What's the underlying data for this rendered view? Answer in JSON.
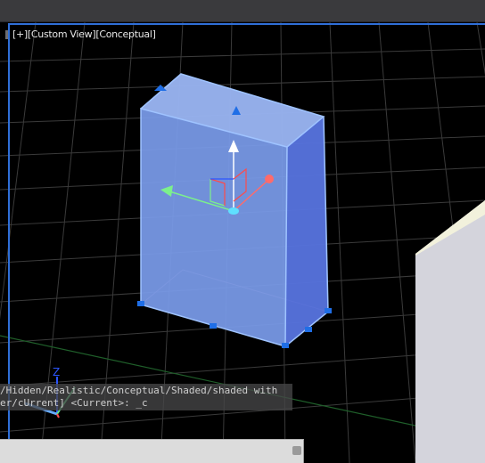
{
  "viewport": {
    "label": "[+][Custom View][Conceptual]",
    "ucs_z_label": "Z"
  },
  "command_history": {
    "line1": "/Hidden/Realistic/Conceptual/Shaded/shaded with",
    "line2": "er/cUrrent] <Current>: _c"
  },
  "command_input": {
    "value": ""
  },
  "colors": {
    "background": "#000000",
    "grid": "#3a3a3a",
    "box_fill": "#7da0f0",
    "box_edge": "#8fb8ff",
    "selection_border": "#2f6fd8",
    "gizmo_x": "#ff6b6b",
    "gizmo_y": "#7cf08c",
    "gizmo_z": "#ffffff"
  },
  "icons": [
    "move-gizmo-icon",
    "grip-icon",
    "ucs-icon"
  ]
}
